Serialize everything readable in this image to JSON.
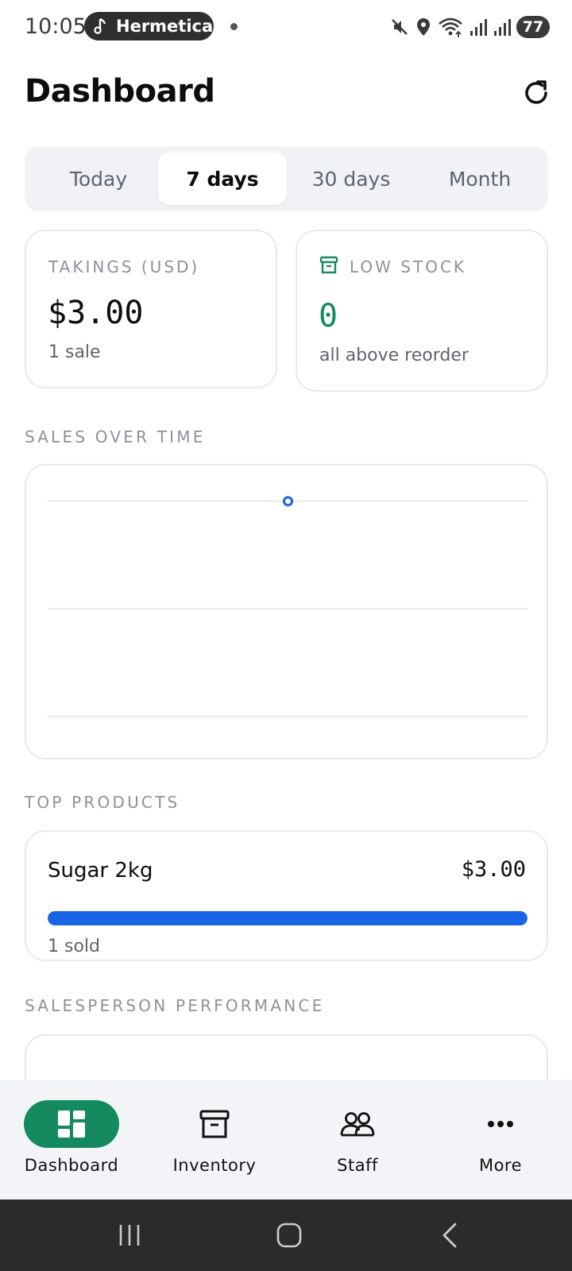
{
  "status_bar": {
    "time": "10:05",
    "media_app": "Hermetica",
    "battery": "77"
  },
  "header": {
    "title": "Dashboard",
    "refresh_icon": "refresh-icon"
  },
  "range_tabs": [
    {
      "label": "Today",
      "active": false
    },
    {
      "label": "7 days",
      "active": true
    },
    {
      "label": "30 days",
      "active": false
    },
    {
      "label": "Month",
      "active": false
    }
  ],
  "stats": {
    "takings": {
      "label": "TAKINGS (USD)",
      "value": "$3.00",
      "sub": "1 sale"
    },
    "low_stock": {
      "label": "LOW STOCK",
      "value": "0",
      "sub": "all above reorder",
      "icon": "archive-box-icon",
      "color": "#148a5e"
    }
  },
  "sections": {
    "sales_over_time": "SALES OVER TIME",
    "top_products": "TOP PRODUCTS",
    "salesperson_performance": "SALESPERSON PERFORMANCE"
  },
  "chart_data": {
    "type": "line",
    "series": [
      {
        "values": [
          3
        ]
      }
    ],
    "color": "#1a65e6",
    "grid": true,
    "gridlines": 3
  },
  "top_products": [
    {
      "name": "Sugar 2kg",
      "amount": "$3.00",
      "sold": "1 sold",
      "share": 1.0
    }
  ],
  "bottom_nav": [
    {
      "label": "Dashboard",
      "icon": "dashboard-grid-icon",
      "active": true
    },
    {
      "label": "Inventory",
      "icon": "archive-box-icon",
      "active": false
    },
    {
      "label": "Staff",
      "icon": "people-icon",
      "active": false
    },
    {
      "label": "More",
      "icon": "more-dots-icon",
      "active": false
    }
  ],
  "colors": {
    "accent": "#148a5e",
    "chart_blue": "#1a65e6"
  }
}
